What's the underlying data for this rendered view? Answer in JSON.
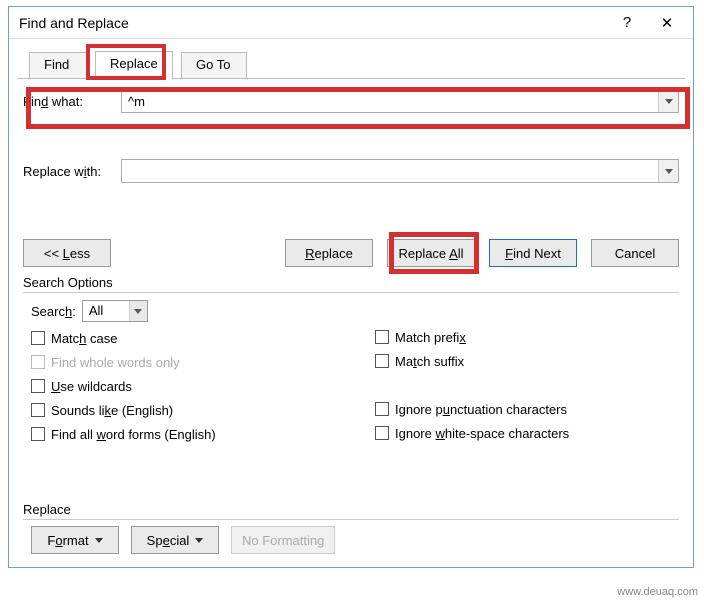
{
  "window": {
    "title": "Find and Replace",
    "help": "?",
    "close": "✕"
  },
  "tabs": {
    "find": "Find",
    "replace": "Replace",
    "goto": "Go To"
  },
  "fields": {
    "find_label": "Find what:",
    "find_value": "^m",
    "replace_label": "Replace with:",
    "replace_value": ""
  },
  "buttons": {
    "less": "<< Less",
    "replace": "Replace",
    "replace_all": "Replace All",
    "find_next": "Find Next",
    "cancel": "Cancel",
    "format": "Format",
    "special": "Special",
    "no_formatting": "No Formatting"
  },
  "search_options": {
    "heading": "Search Options",
    "search_label": "Search:",
    "search_value": "All",
    "match_case": "Match case",
    "whole_words": "Find whole words only",
    "use_wildcards": "Use wildcards",
    "sounds_like": "Sounds like (English)",
    "word_forms": "Find all word forms (English)",
    "match_prefix": "Match prefix",
    "match_suffix": "Match suffix",
    "ignore_punct": "Ignore punctuation characters",
    "ignore_ws": "Ignore white-space characters"
  },
  "replace_section": {
    "heading": "Replace"
  },
  "watermark": "www.deuaq.com"
}
